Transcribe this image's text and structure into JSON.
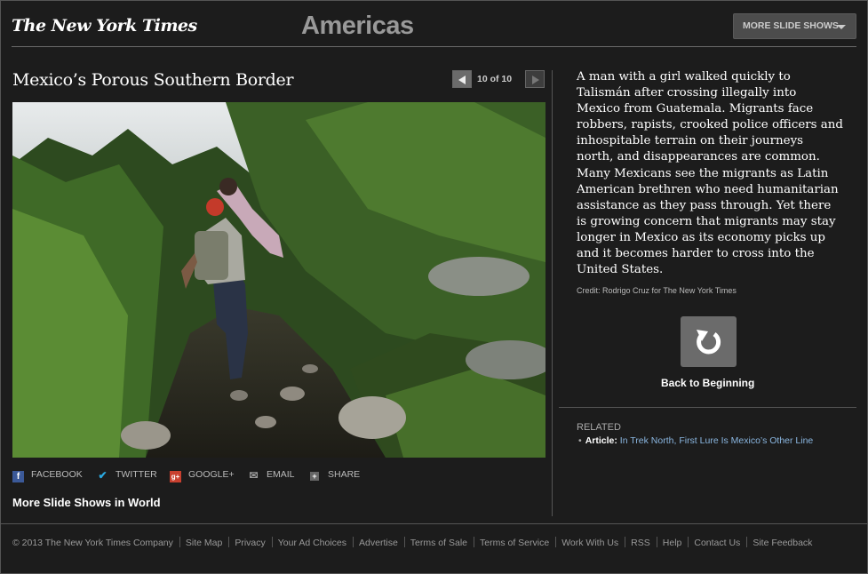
{
  "header": {
    "logo": "The New York Times",
    "section": "Americas",
    "more_slide_shows": "MORE SLIDE SHOWS"
  },
  "slideshow": {
    "title": "Mexico’s Porous Southern Border",
    "counter": "10 of 10",
    "photo_description": "A man with a backpack carrying a girl climbs a rocky dirt path through tall green grass"
  },
  "share": {
    "facebook": "FACEBOOK",
    "twitter": "TWITTER",
    "googleplus": "GOOGLE+",
    "email": "EMAIL",
    "share": "SHARE"
  },
  "more_world": "More Slide Shows in World",
  "caption": "A man with a girl walked quickly to Talismán after crossing illegally into Mexico from Guatemala. Migrants face robbers, rapists, crooked police officers and inhospitable terrain on their journeys north, and disappearances are common. Many Mexicans see the migrants as Latin American brethren who need humanitarian assistance as they pass through. Yet there is growing concern that migrants may stay longer in Mexico as its economy picks up and it becomes harder to cross into the United States.",
  "credit": "Credit: Rodrigo Cruz for The New York Times",
  "back_to_beginning": "Back to Beginning",
  "related": {
    "heading": "RELATED",
    "kind": "Article:",
    "link": "In Trek North, First Lure Is Mexico’s Other Line"
  },
  "footer": {
    "links": [
      "© 2013 The New York Times Company",
      "Site Map",
      "Privacy",
      "Your Ad Choices",
      "Advertise",
      "Terms of Sale",
      "Terms of Service",
      "Work With Us",
      "RSS",
      "Help",
      "Contact Us",
      "Site Feedback"
    ]
  },
  "colors": {
    "background": "#1c1c1c",
    "link": "#8ab6e0",
    "facebook": "#3b5998",
    "twitter": "#2aa9e0",
    "googleplus": "#c8402f"
  },
  "icons": [
    "facebook-icon",
    "twitter-icon",
    "googleplus-icon",
    "email-icon",
    "share-icon",
    "replay-icon",
    "chevron-left-icon",
    "chevron-right-icon",
    "chevron-down-icon"
  ]
}
